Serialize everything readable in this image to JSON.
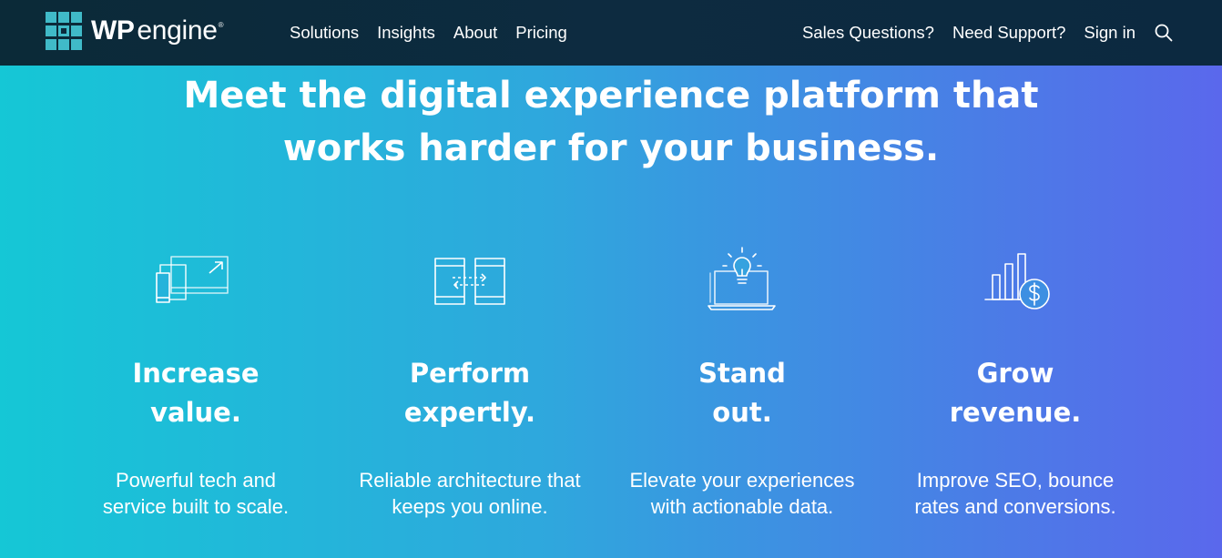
{
  "brand": {
    "logo_wp": "WP",
    "logo_engine": "engine",
    "logo_reg": "®",
    "logo_icon": "wpengine-grid-logo-icon",
    "accent_color": "#40bac8",
    "nav_bg": "#0c2a3c"
  },
  "nav": {
    "left_links": [
      "Solutions",
      "Insights",
      "About",
      "Pricing"
    ],
    "right_links": [
      "Sales Questions?",
      "Need Support?",
      "Sign in"
    ],
    "search_icon": "search-icon"
  },
  "hero": {
    "title_line1": "Meet the digital experience platform that",
    "title_line2": "works harder for your business."
  },
  "features": [
    {
      "icon": "devices-scale-icon",
      "title_line1": "Increase",
      "title_line2": "value.",
      "desc_line1": "Powerful tech and",
      "desc_line2": "service built to scale."
    },
    {
      "icon": "transfer-arrows-icon",
      "title_line1": "Perform",
      "title_line2": "expertly.",
      "desc_line1": "Reliable architecture that",
      "desc_line2": "keeps you online."
    },
    {
      "icon": "laptop-lightbulb-icon",
      "title_line1": "Stand",
      "title_line2": "out.",
      "desc_line1": "Elevate your experiences",
      "desc_line2": "with actionable data."
    },
    {
      "icon": "bar-chart-dollar-icon",
      "title_line1": "Grow",
      "title_line2": "revenue.",
      "desc_line1": "Improve SEO, bounce",
      "desc_line2": "rates and conversions."
    }
  ]
}
